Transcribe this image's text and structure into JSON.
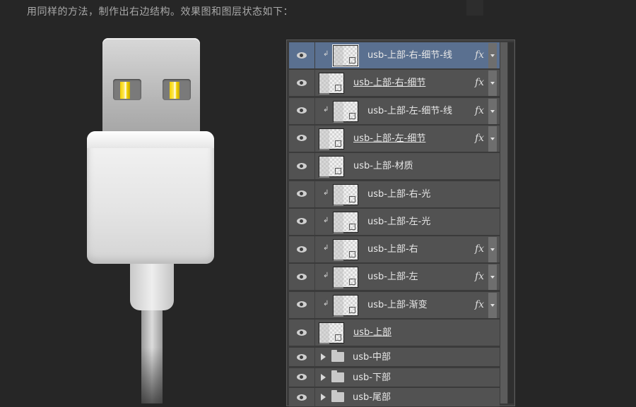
{
  "caption": "用同样的方法，制作出右边结构。效果图和图层状态如下：",
  "layers": [
    {
      "name": "usb-上部-右-细节-线",
      "clipped": true,
      "fx": true,
      "selected": true,
      "underline": false
    },
    {
      "name": "usb-上部-右-细节",
      "clipped": false,
      "fx": true,
      "selected": false,
      "underline": true
    },
    {
      "name": "usb-上部-左-细节-线",
      "clipped": true,
      "fx": true,
      "selected": false,
      "underline": false
    },
    {
      "name": "usb-上部-左-细节",
      "clipped": false,
      "fx": true,
      "selected": false,
      "underline": true
    },
    {
      "name": "usb-上部-材质",
      "clipped": false,
      "fx": false,
      "selected": false,
      "underline": false
    },
    {
      "name": "usb-上部-右-光",
      "clipped": true,
      "fx": false,
      "selected": false,
      "underline": false
    },
    {
      "name": "usb-上部-左-光",
      "clipped": true,
      "fx": false,
      "selected": false,
      "underline": false
    },
    {
      "name": "usb-上部-右",
      "clipped": true,
      "fx": true,
      "selected": false,
      "underline": false
    },
    {
      "name": "usb-上部-左",
      "clipped": true,
      "fx": true,
      "selected": false,
      "underline": false
    },
    {
      "name": "usb-上部-渐变",
      "clipped": true,
      "fx": true,
      "selected": false,
      "underline": false
    },
    {
      "name": "usb-上部",
      "clipped": false,
      "fx": false,
      "selected": false,
      "underline": true
    }
  ],
  "groups": [
    {
      "name": "usb-中部"
    },
    {
      "name": "usb-下部"
    },
    {
      "name": "usb-尾部"
    }
  ],
  "fx_label": "fx",
  "clip_glyph": "↲",
  "colors": {
    "selected_row": "#5a7090",
    "row": "#525252",
    "pin_yellow": "#f2d100"
  }
}
